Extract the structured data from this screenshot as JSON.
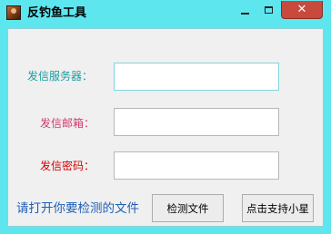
{
  "window": {
    "title": "反钓鱼工具",
    "close_symbol": "✕",
    "icons": {
      "app": "app-icon",
      "minimize": "minimize-icon",
      "maximize": "maximize-icon",
      "close": "close-icon"
    }
  },
  "form": {
    "server_label": "发信服务器：",
    "email_label": "发信邮箱：",
    "password_label": "发信密码：",
    "server_value": "",
    "email_value": "",
    "password_value": ""
  },
  "footer": {
    "hint": "请打开你要检测的文件",
    "check_button": "检测文件",
    "support_button": "点击支持小星"
  },
  "colors": {
    "window_frame": "#5ee6ef",
    "client_bg": "#f0f0f0",
    "server_label": "#1a9ea0",
    "email_label": "#d23b6c",
    "password_label": "#d40000",
    "hint_text": "#1f5fb4",
    "close_button": "#c74a3c"
  }
}
